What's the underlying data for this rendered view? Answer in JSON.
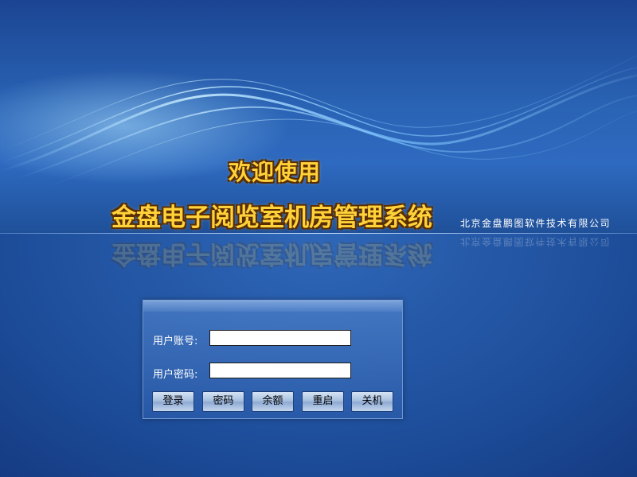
{
  "header": {
    "welcome": "欢迎使用",
    "title": "金盘电子阅览室机房管理系统",
    "company": "北京金盘鹏图软件技术有限公司"
  },
  "login": {
    "username_label": "用户账号:",
    "username_value": "",
    "password_label": "用户密码:",
    "password_value": "",
    "buttons": {
      "login": "登录",
      "password": "密码",
      "balance": "余额",
      "restart": "重启",
      "shutdown": "关机"
    }
  },
  "colors": {
    "background": "#1e4f9c",
    "title_gold": "#ffd23a",
    "title_outline": "#5a2d00",
    "company_text": "#ffffff"
  }
}
